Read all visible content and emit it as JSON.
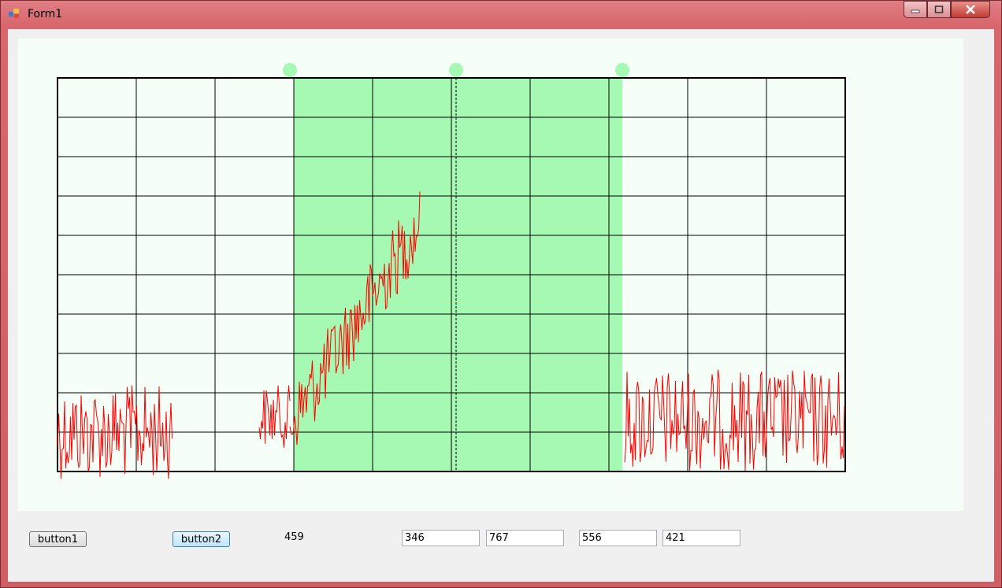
{
  "window": {
    "title": "Form1",
    "icons": {
      "app": "app-icon",
      "minimize": "minimize-icon",
      "maximize": "maximize-icon",
      "close": "close-icon"
    },
    "colors": {
      "frame": "#d7676d",
      "client": "#f0f0f0",
      "panel": "#f5fff7"
    }
  },
  "chart_data": {
    "type": "line",
    "grid": true,
    "columns": 10,
    "rows": 10,
    "selection": {
      "color": "#a6f9b2",
      "handle_color": "#a6f9b2",
      "handles": 3
    },
    "series_color": "#ff0000"
  },
  "controls": {
    "button1_label": "button1",
    "button2_label": "button2",
    "value_label": "459",
    "textbox1_value": "346",
    "textbox2_value": "767",
    "textbox3_value": "556",
    "textbox4_value": "421"
  }
}
